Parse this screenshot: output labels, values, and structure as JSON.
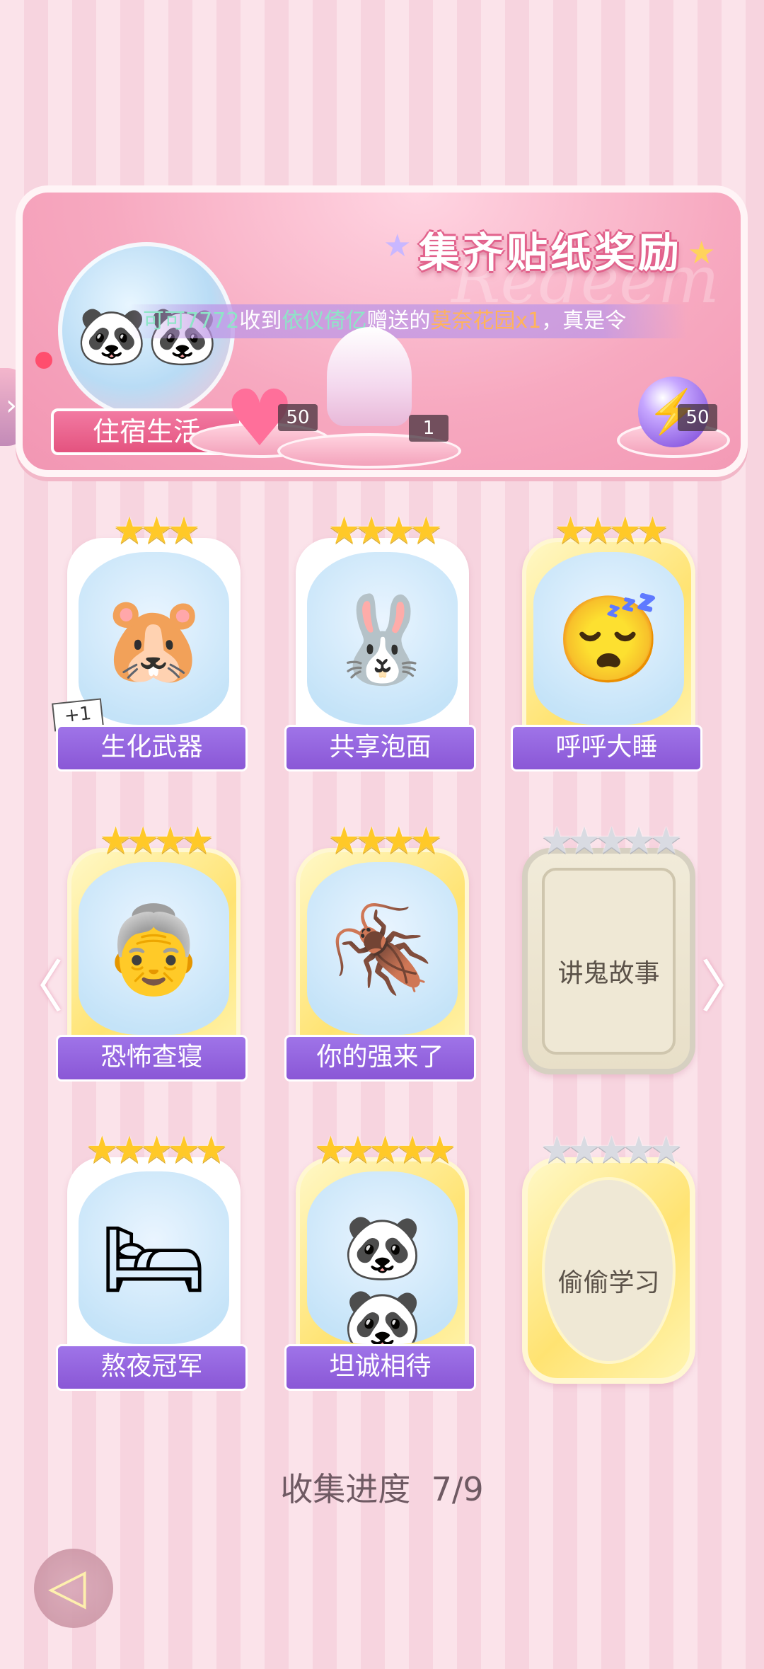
{
  "banner": {
    "title": "集齐贴纸奖励",
    "watermark": "Redeem",
    "scroll_message": {
      "user_from": "可可7772",
      "text_1": "收到",
      "user_to": "依仪倚亿",
      "text_2": "赠送的",
      "item": "莫奈花园x1",
      "text_3": "，真是令"
    },
    "category_label": "住宿生活",
    "rewards": [
      {
        "icon": "heart-gem-icon",
        "count": "50"
      },
      {
        "icon": "dress-icon",
        "count": "1"
      },
      {
        "icon": "energy-orb-icon",
        "count": "50"
      }
    ]
  },
  "cards": [
    {
      "label": "生化武器",
      "stars": "★★★",
      "collected": true,
      "badge": "+1",
      "pic": "🐹"
    },
    {
      "label": "共享泡面",
      "stars": "★★★★",
      "collected": true,
      "pic": "🐰"
    },
    {
      "label": "呼呼大睡",
      "stars": "★★★★",
      "collected": true,
      "pic": "😴"
    },
    {
      "label": "恐怖查寝",
      "stars": "★★★★",
      "collected": true,
      "pic": "👵"
    },
    {
      "label": "你的强来了",
      "stars": "★★★★",
      "collected": true,
      "pic": "🪳"
    },
    {
      "label": "讲鬼故事",
      "stars": "★★★★★",
      "collected": false
    },
    {
      "label": "熬夜冠军",
      "stars": "★★★★★",
      "collected": true,
      "pic": "🛏"
    },
    {
      "label": "坦诚相待",
      "stars": "★★★★★",
      "collected": true,
      "pic": "🐼🐼"
    },
    {
      "label": "偷偷学习",
      "stars": "★★★★★",
      "collected": false
    }
  ],
  "progress": {
    "label": "收集进度",
    "value": "7/9"
  },
  "nav": {
    "prev_arrow": "〈",
    "next_arrow": "〉",
    "side_tab_arrow": "›",
    "back_icon": "◁"
  },
  "colors": {
    "accent": "#e4537f",
    "label_purple": "#8a57d6",
    "star_gold": "#ffc928",
    "star_grey": "#d9dbe2"
  }
}
